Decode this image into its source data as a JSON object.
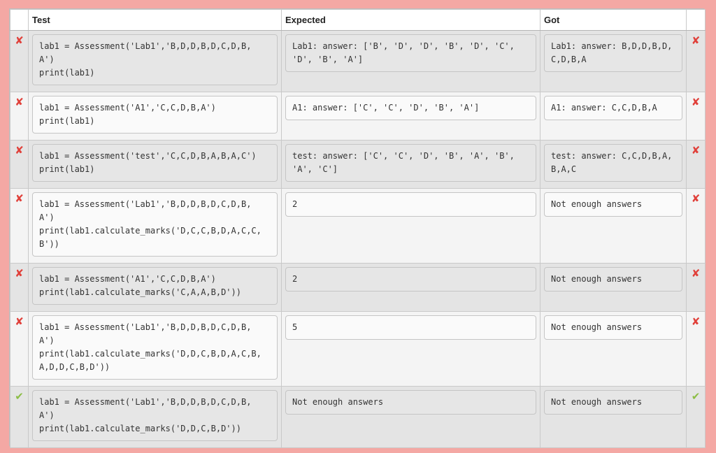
{
  "table": {
    "headers": {
      "test": "Test",
      "expected": "Expected",
      "got": "Got"
    },
    "rows": [
      {
        "status": "fail",
        "status_icon": "cross-icon",
        "test": "lab1 = Assessment('Lab1','B,D,D,B,D,C,D,B,\nA')\nprint(lab1)",
        "expected": "Lab1: answer: ['B', 'D', 'D', 'B', 'D', 'C',\n'D', 'B', 'A']",
        "got": "Lab1: answer: B,D,D,B,D,\nC,D,B,A"
      },
      {
        "status": "fail",
        "status_icon": "cross-icon",
        "test": "lab1 = Assessment('A1','C,C,D,B,A')\nprint(lab1)",
        "expected": "A1: answer: ['C', 'C', 'D', 'B', 'A']",
        "got": "A1: answer: C,C,D,B,A"
      },
      {
        "status": "fail",
        "status_icon": "cross-icon",
        "test": "lab1 = Assessment('test','C,C,D,B,A,B,A,C')\nprint(lab1)",
        "expected": "test: answer: ['C', 'C', 'D', 'B', 'A', 'B',\n'A', 'C']",
        "got": "test: answer: C,C,D,B,A,\nB,A,C"
      },
      {
        "status": "fail",
        "status_icon": "cross-icon",
        "test": "lab1 = Assessment('Lab1','B,D,D,B,D,C,D,B,\nA')\nprint(lab1.calculate_marks('D,C,C,B,D,A,C,C,\nB'))",
        "expected": "2",
        "got": "Not enough answers"
      },
      {
        "status": "fail",
        "status_icon": "cross-icon",
        "test": "lab1 = Assessment('A1','C,C,D,B,A')\nprint(lab1.calculate_marks('C,A,A,B,D'))",
        "expected": "2",
        "got": "Not enough answers"
      },
      {
        "status": "fail",
        "status_icon": "cross-icon",
        "test": "lab1 = Assessment('Lab1','B,D,D,B,D,C,D,B,\nA')\nprint(lab1.calculate_marks('D,D,C,B,D,A,C,B,\nA,D,D,C,B,D'))",
        "expected": "5",
        "got": "Not enough answers"
      },
      {
        "status": "pass",
        "status_icon": "tick-icon",
        "test": "lab1 = Assessment('Lab1','B,D,D,B,D,C,D,B,\nA')\nprint(lab1.calculate_marks('D,D,C,B,D'))",
        "expected": "Not enough answers",
        "got": "Not enough answers"
      }
    ]
  },
  "colors": {
    "page_background": "#f4a8a4",
    "fail_icon": "#e0403a",
    "pass_icon": "#8cbd45"
  }
}
